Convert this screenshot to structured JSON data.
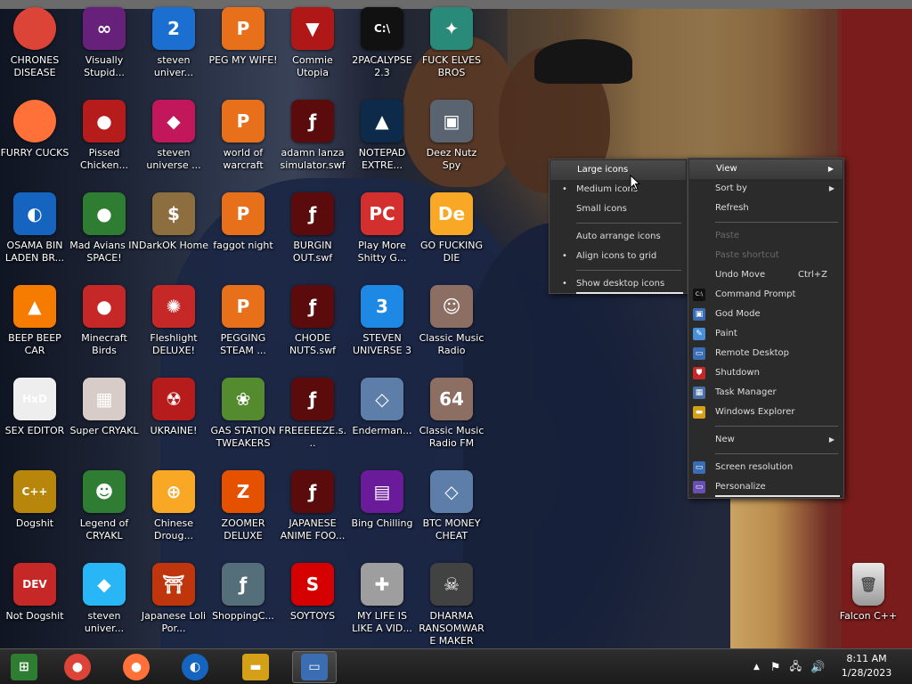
{
  "desktop": {
    "icons": [
      {
        "label": "CHRONES DISEASE",
        "icon": "chrome-icon",
        "glyph": "",
        "color": "#db4437"
      },
      {
        "label": "Visually Stupid...",
        "icon": "visual-studio-icon",
        "glyph": "∞",
        "color": "#68217a"
      },
      {
        "label": "steven univer...",
        "icon": "number-two-icon",
        "glyph": "2",
        "color": "#1b6fd1"
      },
      {
        "label": "PEG MY WIFE!",
        "icon": "peggle-icon",
        "glyph": "P",
        "color": "#e8701a"
      },
      {
        "label": "Commie Utopia",
        "icon": "ussr-icon",
        "glyph": "▼",
        "color": "#b01818"
      },
      {
        "label": "2PACALYPSE 2.3",
        "icon": "cmd-icon",
        "glyph": "C:\\",
        "color": "#111111"
      },
      {
        "label": "FUCK ELVES BROS",
        "icon": "santa-icon",
        "glyph": "✦",
        "color": "#2a8a7a"
      },
      {
        "label": "FURRY CUCKS",
        "icon": "firefox-icon",
        "glyph": "",
        "color": "#ff7139"
      },
      {
        "label": "Pissed Chicken...",
        "icon": "angry-birds-seasons-icon",
        "glyph": "●",
        "color": "#b71c1c"
      },
      {
        "label": "steven universe ...",
        "icon": "gem-icon",
        "glyph": "◆",
        "color": "#c2185b"
      },
      {
        "label": "world of warcraft",
        "icon": "peggle-icon",
        "glyph": "P",
        "color": "#e8701a"
      },
      {
        "label": "adamn lanza simulator.swf",
        "icon": "flash-icon",
        "glyph": "ƒ",
        "color": "#5b0b0b"
      },
      {
        "label": "NOTEPAD EXTRE...",
        "icon": "notepad-extreme-icon",
        "glyph": "▲",
        "color": "#0d2a4a"
      },
      {
        "label": "Deez Nutz Spy",
        "icon": "windows-stack-icon",
        "glyph": "▣",
        "color": "#5a6470"
      },
      {
        "label": "OSAMA BIN LADEN BR...",
        "icon": "obama-logo-icon",
        "glyph": "◐",
        "color": "#1565c0"
      },
      {
        "label": "Mad Avians IN SPACE!",
        "icon": "angry-birds-space-icon",
        "glyph": "●",
        "color": "#2e7d32"
      },
      {
        "label": "DarkOK Home",
        "icon": "money-bag-icon",
        "glyph": "$",
        "color": "#8d6e3f"
      },
      {
        "label": "faggot night",
        "icon": "peggle-icon",
        "glyph": "P",
        "color": "#e8701a"
      },
      {
        "label": "BURGIN OUT.swf",
        "icon": "flash-icon",
        "glyph": "ƒ",
        "color": "#5b0b0b"
      },
      {
        "label": "Play More Shitty G...",
        "icon": "popcap-icon",
        "glyph": "PC",
        "color": "#d32f2f"
      },
      {
        "label": "GO FUCKING DIE",
        "icon": "de-icon",
        "glyph": "De",
        "color": "#f9a825"
      },
      {
        "label": "BEEP BEEP CAR",
        "icon": "vlc-icon",
        "glyph": "▲",
        "color": "#f57c00"
      },
      {
        "label": "Minecraft Birds",
        "icon": "angry-bird-icon",
        "glyph": "●",
        "color": "#c62828"
      },
      {
        "label": "Fleshlight DELUXE!",
        "icon": "red-fuzzy-icon",
        "glyph": "✺",
        "color": "#c62828"
      },
      {
        "label": "PEGGING STEAM ...",
        "icon": "peggle-icon",
        "glyph": "P",
        "color": "#e8701a"
      },
      {
        "label": "CHODE NUTS.swf",
        "icon": "flash-icon",
        "glyph": "ƒ",
        "color": "#5b0b0b"
      },
      {
        "label": "STEVEN UNIVERSE 3",
        "icon": "number-three-icon",
        "glyph": "3",
        "color": "#1e88e5"
      },
      {
        "label": "Classic Music Radio",
        "icon": "portrait-icon",
        "glyph": "☺",
        "color": "#8d6e63"
      },
      {
        "label": "SEX EDITOR",
        "icon": "hxd-icon",
        "glyph": "HxD",
        "color": "#eeeeee"
      },
      {
        "label": "Super CRYAKL",
        "icon": "pixel-character-icon",
        "glyph": "▦",
        "color": "#d7ccc8"
      },
      {
        "label": "UKRAINE!",
        "icon": "radiation-icon",
        "glyph": "☢",
        "color": "#b71c1c"
      },
      {
        "label": "GAS STATION TWEAKERS",
        "icon": "plant-icon",
        "glyph": "❀",
        "color": "#558b2f"
      },
      {
        "label": "FREEEEEZE.s...",
        "icon": "flash-icon",
        "glyph": "ƒ",
        "color": "#5b0b0b"
      },
      {
        "label": "Enderman...",
        "icon": "blue-diamond-icon",
        "glyph": "◇",
        "color": "#5c7ea8"
      },
      {
        "label": "Classic Music Radio FM",
        "icon": "portrait-64-icon",
        "glyph": "64",
        "color": "#8d6e63"
      },
      {
        "label": "Dogshit",
        "icon": "gold-disc-icon",
        "glyph": "C++",
        "color": "#b8860b"
      },
      {
        "label": "Legend of CRYAKL",
        "icon": "pixel-hero-icon",
        "glyph": "☻",
        "color": "#2e7d32"
      },
      {
        "label": "Chinese Droug...",
        "icon": "mahjong-icon",
        "glyph": "⊕",
        "color": "#f9a825"
      },
      {
        "label": "ZOOMER DELUXE",
        "icon": "orange-shape-icon",
        "glyph": "Z",
        "color": "#e65100"
      },
      {
        "label": "JAPANESE ANIME FOO...",
        "icon": "flash-icon",
        "glyph": "ƒ",
        "color": "#5b0b0b"
      },
      {
        "label": "Bing Chilling",
        "icon": "game-box-icon",
        "glyph": "▤",
        "color": "#6a1b9a"
      },
      {
        "label": "BTC MONEY CHEAT",
        "icon": "blue-diamond-icon",
        "glyph": "◇",
        "color": "#5c7ea8"
      },
      {
        "label": "Not Dogshit",
        "icon": "dev-cpp-icon",
        "glyph": "DEV",
        "color": "#c62828"
      },
      {
        "label": "steven univer...",
        "icon": "diamond-gem-icon",
        "glyph": "◆",
        "color": "#29b6f6"
      },
      {
        "label": "Japanese Loli Por...",
        "icon": "torii-icon",
        "glyph": "⛩",
        "color": "#bf360c"
      },
      {
        "label": "ShoppingC...",
        "icon": "flash-player-icon",
        "glyph": "ƒ",
        "color": "#546e7a"
      },
      {
        "label": "SOYTOYS",
        "icon": "red-s-icon",
        "glyph": "S",
        "color": "#d50000"
      },
      {
        "label": "MY LIFE IS LIKE A VID...",
        "icon": "gamepad-icon",
        "glyph": "✚",
        "color": "#9e9e9e"
      },
      {
        "label": "DHARMA RANSOMWARE MAKER",
        "icon": "skull-icon",
        "glyph": "☠",
        "color": "#424242"
      }
    ],
    "recycle_bin_label": "Falcon C++"
  },
  "view_submenu": {
    "items": [
      {
        "label": "Large icons",
        "bullet": "",
        "highlighted": true
      },
      {
        "label": "Medium icons",
        "bullet": "•",
        "highlighted": false
      },
      {
        "label": "Small icons",
        "bullet": "",
        "highlighted": false
      }
    ],
    "items2": [
      {
        "label": "Auto arrange icons",
        "bullet": ""
      },
      {
        "label": "Align icons to grid",
        "bullet": "•"
      }
    ],
    "show_desktop_icons": {
      "label": "Show desktop icons",
      "bullet": "•"
    }
  },
  "context_menu": {
    "view": "View",
    "sort_by": "Sort by",
    "refresh": "Refresh",
    "paste": "Paste",
    "paste_shortcut": "Paste shortcut",
    "undo_move": "Undo Move",
    "undo_shortcut": "Ctrl+Z",
    "tools": [
      {
        "label": "Command Prompt",
        "icon": "cmd-icon",
        "glyph": "C:\\",
        "color": "#111111"
      },
      {
        "label": "God Mode",
        "icon": "control-panel-icon",
        "glyph": "▣",
        "color": "#3b6db3"
      },
      {
        "label": "Paint",
        "icon": "paint-icon",
        "glyph": "✎",
        "color": "#4a90d9"
      },
      {
        "label": "Remote Desktop",
        "icon": "remote-desktop-icon",
        "glyph": "▭",
        "color": "#3b6db3"
      },
      {
        "label": "Shutdown",
        "icon": "shield-icon",
        "glyph": "⛊",
        "color": "#c62828"
      },
      {
        "label": "Task Manager",
        "icon": "task-manager-icon",
        "glyph": "▦",
        "color": "#4a6fa5"
      },
      {
        "label": "Windows Explorer",
        "icon": "folder-icon",
        "glyph": "▬",
        "color": "#d4a017"
      }
    ],
    "new": "New",
    "screen_resolution": "Screen resolution",
    "personalize": "Personalize",
    "screen_icon": "monitor-icon",
    "personalize_icon": "personalize-icon"
  },
  "taskbar": {
    "pinned": [
      {
        "name": "taskbar-start-button",
        "icon": "windows-orb-icon",
        "glyph": "⊞",
        "color": "#2e7d32"
      },
      {
        "name": "taskbar-chrome",
        "icon": "chrome-icon",
        "glyph": "●",
        "color": "#db4437"
      },
      {
        "name": "taskbar-firefox",
        "icon": "firefox-icon",
        "glyph": "●",
        "color": "#ff7139"
      },
      {
        "name": "taskbar-obama-logo",
        "icon": "obama-logo-icon",
        "glyph": "◐",
        "color": "#1565c0"
      },
      {
        "name": "taskbar-explorer",
        "icon": "folder-icon",
        "glyph": "▬",
        "color": "#d4a017"
      },
      {
        "name": "taskbar-desktop-app",
        "icon": "picture-icon",
        "glyph": "▭",
        "color": "#3b6db3"
      }
    ],
    "time": "8:11 AM",
    "date": "1/28/2023"
  }
}
